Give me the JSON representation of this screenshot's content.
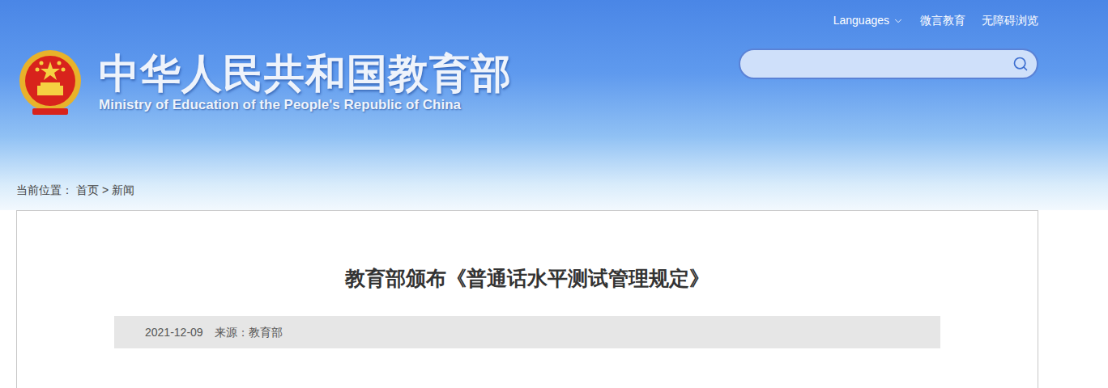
{
  "header": {
    "title": "中华人民共和国教育部",
    "subtitle": "Ministry of Education of the People's Republic of China"
  },
  "top_links": [
    {
      "label": "Languages",
      "has_menu": true
    },
    {
      "label": "微言教育",
      "has_menu": false
    },
    {
      "label": "无障碍浏览",
      "has_menu": false
    }
  ],
  "breadcrumb": {
    "label": "当前位置：",
    "separator": ">",
    "items": [
      "首页",
      "新闻"
    ]
  },
  "article": {
    "title": "教育部颁布《普通话水平测试管理规定》",
    "date": "2021-12-09",
    "source": "来源：教育部"
  }
}
